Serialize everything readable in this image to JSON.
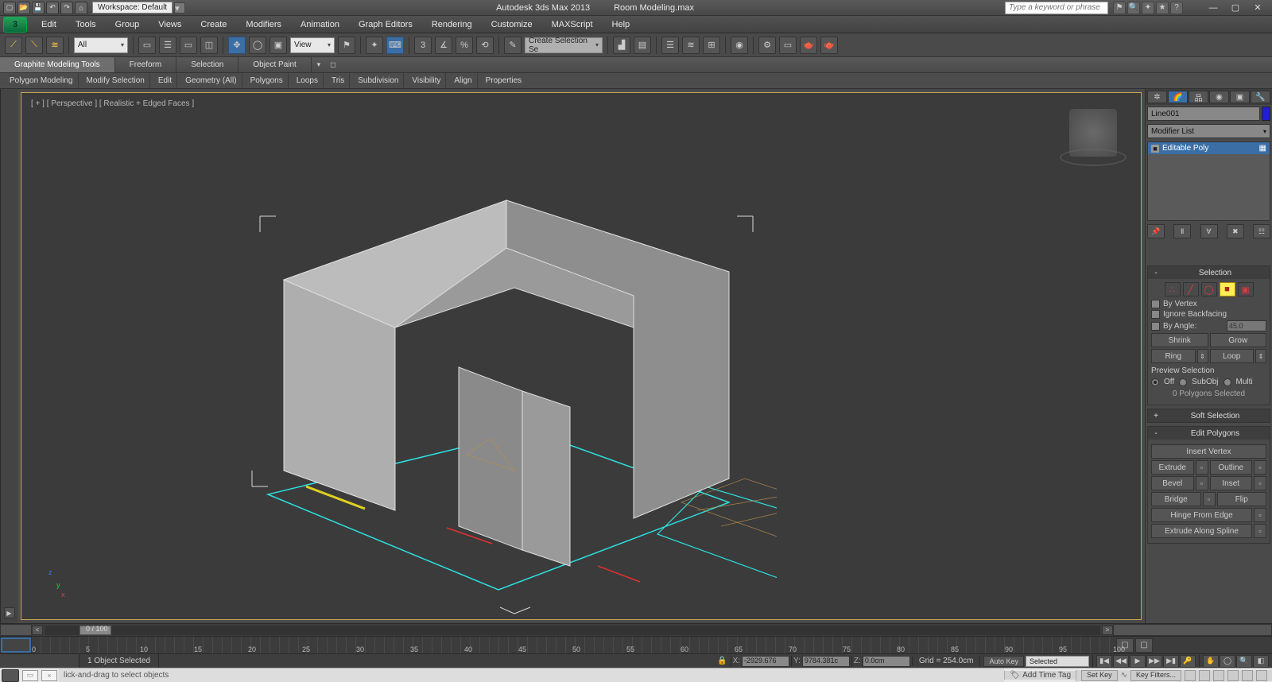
{
  "title": {
    "app": "Autodesk 3ds Max  2013",
    "file": "Room Modeling.max"
  },
  "workspace": {
    "label": "Workspace: Default"
  },
  "search": {
    "placeholder": "Type a keyword or phrase"
  },
  "menus": [
    "Edit",
    "Tools",
    "Group",
    "Views",
    "Create",
    "Modifiers",
    "Animation",
    "Graph Editors",
    "Rendering",
    "Customize",
    "MAXScript",
    "Help"
  ],
  "toolbar": {
    "selection_filter": "All",
    "ref_coord": "View",
    "named_sel": "Create Selection Se"
  },
  "ribbon_tabs": [
    "Graphite Modeling Tools",
    "Freeform",
    "Selection",
    "Object Paint"
  ],
  "subribbon": [
    "Polygon Modeling",
    "Modify Selection",
    "Edit",
    "Geometry (All)",
    "Polygons",
    "Loops",
    "Tris",
    "Subdivision",
    "Visibility",
    "Align",
    "Properties"
  ],
  "viewport": {
    "label": "[ + ] [ Perspective ] [ Realistic + Edged Faces ]"
  },
  "axis": {
    "x": "x",
    "y": "y",
    "z": "z"
  },
  "command_panel": {
    "object_name": "Line001",
    "modifier_list": "Modifier List",
    "stack_item": "Editable Poly",
    "selection": {
      "title": "Selection",
      "by_vertex": "By Vertex",
      "ignore_backfacing": "Ignore Backfacing",
      "by_angle": "By Angle:",
      "angle_value": "45.0",
      "shrink": "Shrink",
      "grow": "Grow",
      "ring": "Ring",
      "loop": "Loop",
      "preview_label": "Preview Selection",
      "off": "Off",
      "subobj": "SubObj",
      "multi": "Multi",
      "info": "0 Polygons Selected"
    },
    "soft_selection": {
      "title": "Soft Selection"
    },
    "edit_polys": {
      "title": "Edit Polygons",
      "insert_vertex": "Insert Vertex",
      "extrude": "Extrude",
      "outline": "Outline",
      "bevel": "Bevel",
      "inset": "Inset",
      "bridge": "Bridge",
      "flip": "Flip",
      "hinge": "Hinge From Edge",
      "extrude_spline": "Extrude Along Spline"
    }
  },
  "timeline": {
    "range": "0 / 100",
    "ticks": [
      "0",
      "5",
      "10",
      "15",
      "20",
      "25",
      "30",
      "35",
      "40",
      "45",
      "50",
      "55",
      "60",
      "65",
      "70",
      "75",
      "80",
      "85",
      "90",
      "95",
      "100"
    ]
  },
  "status": {
    "selection": "1 Object Selected",
    "x": "-2929.676",
    "y": "9784.381c",
    "z": "0.0cm",
    "grid": "Grid = 254.0cm",
    "autokey": "Auto Key",
    "setkey": "Set Key",
    "key_mode": "Selected",
    "key_filters": "Key Filters..."
  },
  "status2": {
    "prompt": "lick-and-drag to select objects",
    "add_time_tag": "Add Time Tag"
  }
}
